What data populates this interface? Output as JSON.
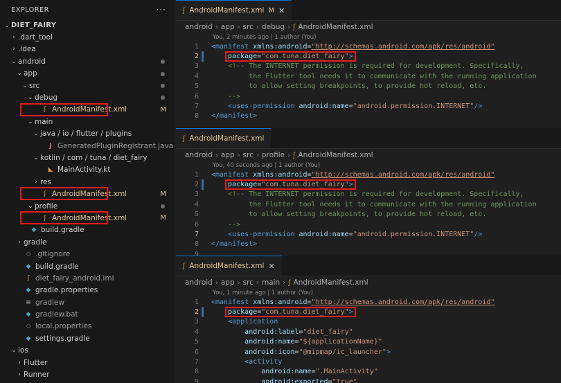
{
  "explorer": {
    "title": "EXPLORER",
    "more": "···",
    "items": [
      {
        "label": "DIET_FAIRY",
        "indent": 0,
        "chev": "⌄",
        "icon": "",
        "root": true
      },
      {
        "label": ".dart_tool",
        "indent": 1,
        "chev": "›",
        "icon": ""
      },
      {
        "label": ".idea",
        "indent": 1,
        "chev": "›",
        "icon": ""
      },
      {
        "label": "android",
        "indent": 1,
        "chev": "⌄",
        "icon": "",
        "dot": true,
        "mod": true
      },
      {
        "label": "app",
        "indent": 2,
        "chev": "⌄",
        "icon": "",
        "dot": true,
        "mod": true
      },
      {
        "label": "src",
        "indent": 3,
        "chev": "⌄",
        "icon": "",
        "dot": true,
        "mod": true
      },
      {
        "label": "debug",
        "indent": 4,
        "chev": "⌄",
        "icon": "",
        "dot": true,
        "mod": true
      },
      {
        "label": "AndroidManifest.xml",
        "indent": 5,
        "chev": "",
        "icon": "rss",
        "badge": "M",
        "modified": true
      },
      {
        "label": "main",
        "indent": 4,
        "chev": "⌄",
        "icon": ""
      },
      {
        "label": "java / io / flutter / plugins",
        "indent": 5,
        "chev": "⌄",
        "icon": ""
      },
      {
        "label": "GeneratedPluginRegistrant.java",
        "indent": 6,
        "chev": "",
        "icon": "java",
        "dim": true
      },
      {
        "label": "kotlin / com / tuna / diet_fairy",
        "indent": 5,
        "chev": "⌄",
        "icon": ""
      },
      {
        "label": "MainActivity.kt",
        "indent": 6,
        "chev": "",
        "icon": "kt"
      },
      {
        "label": "res",
        "indent": 5,
        "chev": "›",
        "icon": ""
      },
      {
        "label": "AndroidManifest.xml",
        "indent": 5,
        "chev": "",
        "icon": "rss",
        "badge": "M",
        "modified": true
      },
      {
        "label": "profile",
        "indent": 4,
        "chev": "⌄",
        "icon": "",
        "dot": true,
        "mod": true
      },
      {
        "label": "AndroidManifest.xml",
        "indent": 5,
        "chev": "",
        "icon": "rss",
        "badge": "M",
        "modified": true
      },
      {
        "label": "build.gradle",
        "indent": 3,
        "chev": "",
        "icon": "elephant"
      },
      {
        "label": "gradle",
        "indent": 2,
        "chev": "›",
        "icon": ""
      },
      {
        "label": ".gitignore",
        "indent": 2,
        "chev": "",
        "icon": "gear",
        "dim": true
      },
      {
        "label": "build.gradle",
        "indent": 2,
        "chev": "",
        "icon": "elephant"
      },
      {
        "label": "diet_fairy_android.iml",
        "indent": 2,
        "chev": "",
        "icon": "rss",
        "dim": true
      },
      {
        "label": "gradle.properties",
        "indent": 2,
        "chev": "",
        "icon": "elephant"
      },
      {
        "label": "gradlew",
        "indent": 2,
        "chev": "",
        "icon": "list",
        "dim": true
      },
      {
        "label": "gradlew.bat",
        "indent": 2,
        "chev": "",
        "icon": "elephant",
        "dim": true
      },
      {
        "label": "local.properties",
        "indent": 2,
        "chev": "",
        "icon": "gear",
        "dim": true
      },
      {
        "label": "settings.gradle",
        "indent": 2,
        "chev": "",
        "icon": "elephant"
      },
      {
        "label": "ios",
        "indent": 1,
        "chev": "⌄",
        "icon": ""
      },
      {
        "label": "Flutter",
        "indent": 2,
        "chev": "›",
        "icon": ""
      },
      {
        "label": "Runner",
        "indent": 2,
        "chev": "›",
        "icon": ""
      }
    ]
  },
  "panes": [
    {
      "tab": {
        "label": "AndroidManifest.xml",
        "badge": "M",
        "close": "✕"
      },
      "crumbs": [
        "android",
        "app",
        "src",
        "debug",
        "AndroidManifest.xml"
      ],
      "blame": "You, 2 minutes ago | 1 author (You)",
      "lines": [
        {
          "n": "1",
          "parts": [
            [
              "tag",
              "<manifest "
            ],
            [
              "attr",
              "xmlns:android"
            ],
            [
              "txt",
              "="
            ],
            [
              "url",
              "\"http://schemas.android.com/apk/res/android\""
            ]
          ]
        },
        {
          "n": "2",
          "cur": true,
          "parts": [
            [
              "txt",
              "    "
            ],
            [
              "attr",
              "package"
            ],
            [
              "txt",
              "="
            ],
            [
              "str",
              "\"com.tuna.diet_fairy\""
            ],
            [
              "tag",
              ">"
            ]
          ]
        },
        {
          "n": "3",
          "parts": [
            [
              "txt",
              "    "
            ],
            [
              "cmt",
              "<!-- The INTERNET permission is required for development. Specifically,"
            ]
          ]
        },
        {
          "n": "4",
          "parts": [
            [
              "cmt",
              "         the Flutter tool needs it to communicate with the running application"
            ]
          ]
        },
        {
          "n": "5",
          "parts": [
            [
              "cmt",
              "         to allow setting breakpoints, to provide hot reload, etc."
            ]
          ]
        },
        {
          "n": "6",
          "parts": [
            [
              "cmt",
              "    -->"
            ]
          ]
        },
        {
          "n": "7",
          "parts": [
            [
              "txt",
              "    "
            ],
            [
              "tag",
              "<uses-permission "
            ],
            [
              "attr",
              "android:name"
            ],
            [
              "txt",
              "="
            ],
            [
              "str",
              "\"android.permission.INTERNET\""
            ],
            [
              "tag",
              "/>"
            ]
          ]
        },
        {
          "n": "8",
          "parts": [
            [
              "tag",
              "</manifest>"
            ]
          ]
        }
      ]
    },
    {
      "tab": {
        "label": "AndroidManifest.xml",
        "badge": "",
        "close": ""
      },
      "crumbs": [
        "android",
        "app",
        "src",
        "profile",
        "AndroidManifest.xml"
      ],
      "blame": "You, 40 seconds ago | 1 author (You)",
      "lines": [
        {
          "n": "1",
          "parts": [
            [
              "tag",
              "<manifest "
            ],
            [
              "attr",
              "xmlns:android"
            ],
            [
              "txt",
              "="
            ],
            [
              "url",
              "\"http://schemas.android.com/apk/res/android\""
            ]
          ]
        },
        {
          "n": "2",
          "parts": [
            [
              "txt",
              "    "
            ],
            [
              "attr",
              "package"
            ],
            [
              "txt",
              "="
            ],
            [
              "str",
              "\"com.tuna.diet_fairy\""
            ],
            [
              "tag",
              ">"
            ]
          ]
        },
        {
          "n": "3",
          "parts": [
            [
              "txt",
              "    "
            ],
            [
              "cmt",
              "<!-- The INTERNET permission is required for development. Specifically,"
            ]
          ]
        },
        {
          "n": "4",
          "parts": [
            [
              "cmt",
              "         the Flutter tool needs it to communicate with the running application"
            ]
          ]
        },
        {
          "n": "5",
          "parts": [
            [
              "cmt",
              "         to allow setting breakpoints, to provide hot reload, etc."
            ]
          ]
        },
        {
          "n": "6",
          "parts": [
            [
              "cmt",
              "    -->"
            ]
          ]
        },
        {
          "n": "7",
          "cur": true,
          "parts": [
            [
              "txt",
              "    "
            ],
            [
              "tag",
              "<uses-permission "
            ],
            [
              "attr",
              "android:name"
            ],
            [
              "txt",
              "="
            ],
            [
              "str",
              "\"android.permission.INTERNET\""
            ],
            [
              "tag",
              "/>"
            ]
          ]
        },
        {
          "n": "8",
          "parts": [
            [
              "tag",
              "</manifest>"
            ]
          ]
        },
        {
          "n": "9",
          "parts": []
        }
      ]
    },
    {
      "tab": {
        "label": "AndroidManifest.xml",
        "badge": "",
        "close": "✕"
      },
      "crumbs": [
        "android",
        "app",
        "src",
        "main",
        "AndroidManifest.xml"
      ],
      "blame": "You, 1 minute ago | 1 author (You)",
      "lines": [
        {
          "n": "1",
          "parts": [
            [
              "tag",
              "<manifest "
            ],
            [
              "attr",
              "xmlns:android"
            ],
            [
              "txt",
              "="
            ],
            [
              "url",
              "\"http://schemas.android.com/apk/res/android\""
            ]
          ]
        },
        {
          "n": "2",
          "cur": true,
          "parts": [
            [
              "txt",
              "    "
            ],
            [
              "attr",
              "package"
            ],
            [
              "txt",
              "="
            ],
            [
              "str",
              "\"com.tuna.diet_fairy\""
            ],
            [
              "tag",
              ">"
            ]
          ]
        },
        {
          "n": "3",
          "parts": [
            [
              "txt",
              "    "
            ],
            [
              "tag",
              "<application"
            ]
          ]
        },
        {
          "n": "4",
          "parts": [
            [
              "txt",
              "        "
            ],
            [
              "attr",
              "android:label"
            ],
            [
              "txt",
              "="
            ],
            [
              "str",
              "\"diet_fairy\""
            ]
          ]
        },
        {
          "n": "5",
          "parts": [
            [
              "txt",
              "        "
            ],
            [
              "attr",
              "android:name"
            ],
            [
              "txt",
              "="
            ],
            [
              "str",
              "\"${applicationName}\""
            ]
          ]
        },
        {
          "n": "6",
          "parts": [
            [
              "txt",
              "        "
            ],
            [
              "attr",
              "android:icon"
            ],
            [
              "txt",
              "="
            ],
            [
              "str",
              "\"@mipmap/ic_launcher\""
            ],
            [
              "tag",
              ">"
            ]
          ]
        },
        {
          "n": "7",
          "parts": [
            [
              "txt",
              "        "
            ],
            [
              "tag",
              "<activity"
            ]
          ]
        },
        {
          "n": "8",
          "parts": [
            [
              "txt",
              "            "
            ],
            [
              "attr",
              "android:name"
            ],
            [
              "txt",
              "="
            ],
            [
              "str",
              "\".MainActivity\""
            ]
          ]
        },
        {
          "n": "9",
          "parts": [
            [
              "txt",
              "            "
            ],
            [
              "attr",
              "android:exported"
            ],
            [
              "txt",
              "="
            ],
            [
              "str",
              "\"true\""
            ]
          ]
        }
      ]
    }
  ]
}
